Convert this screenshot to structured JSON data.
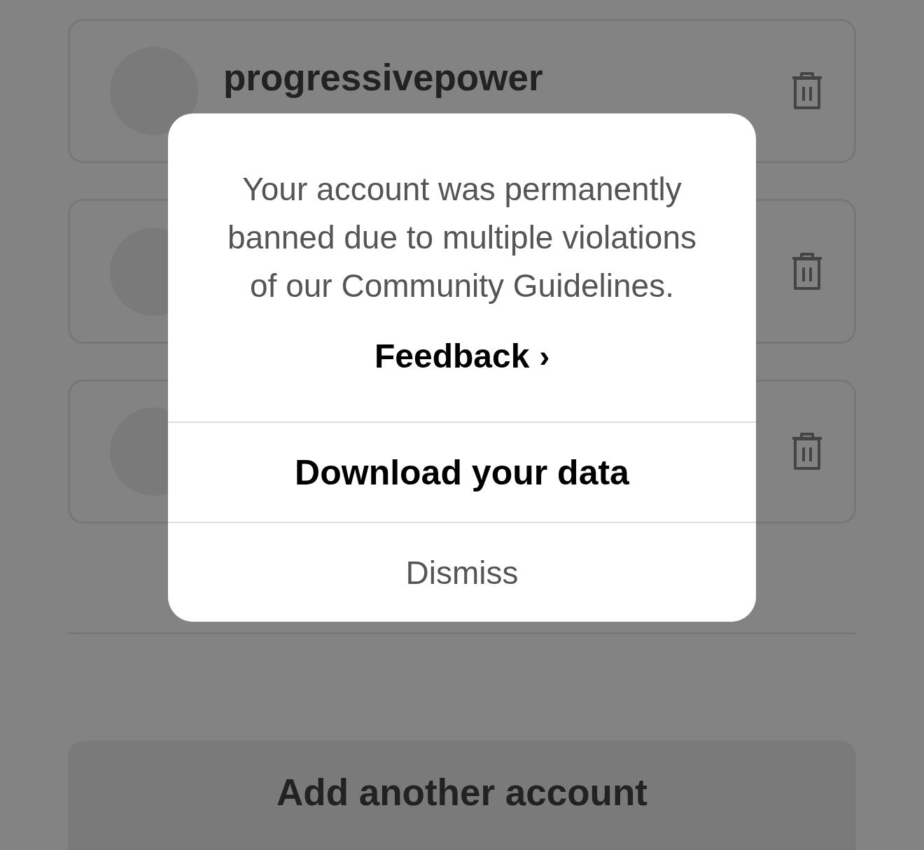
{
  "accounts": [
    {
      "kind": "named",
      "username": "progressivepower"
    },
    {
      "kind": "hidden"
    },
    {
      "kind": "hidden"
    }
  ],
  "add_account_button": "Add another account",
  "dialog": {
    "message": "Your account was permanently banned due to multiple violations of our Community Guidelines.",
    "link": "Feedback",
    "link_chevron": "›",
    "actions": [
      {
        "label": "Download your data",
        "kind": "primary"
      },
      {
        "label": "Dismiss",
        "kind": "secondary"
      }
    ]
  }
}
